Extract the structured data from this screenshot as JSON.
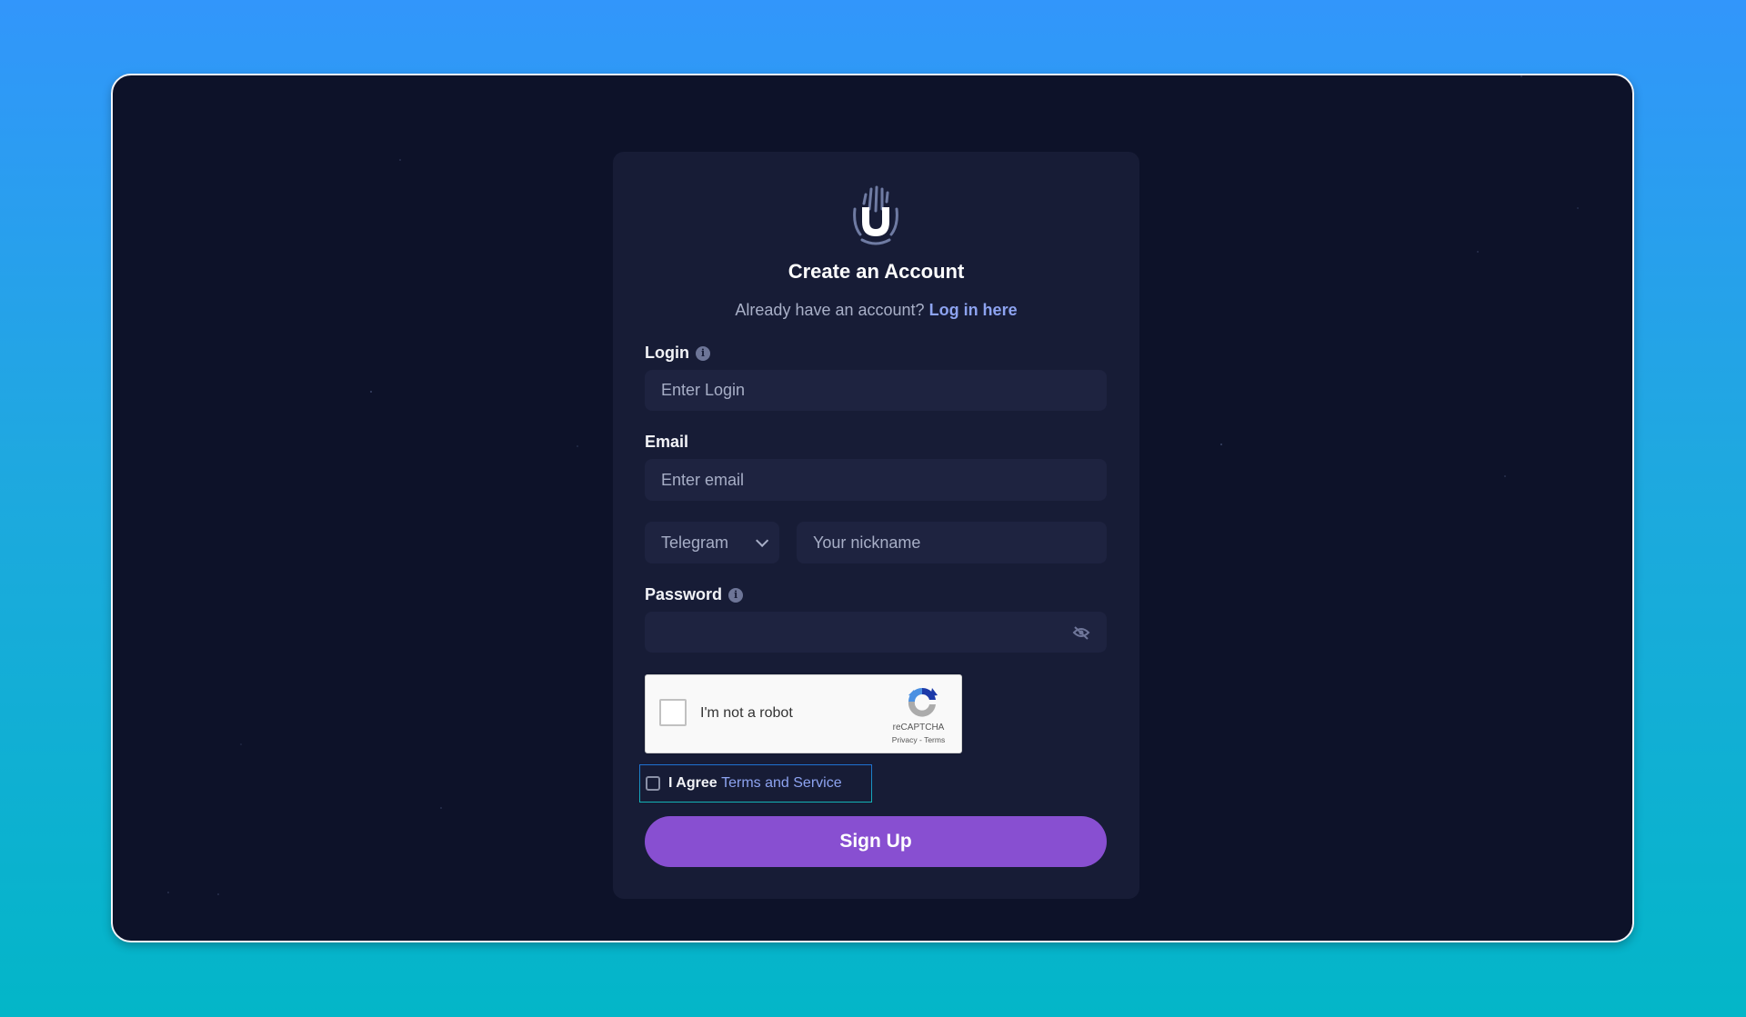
{
  "app": {
    "title": "Create an Account",
    "colors": {
      "page_gradient_top": "#3296fb",
      "page_gradient_bottom": "#03b6c8",
      "frame_bg": "#0d1229",
      "card_bg": "#171c36",
      "input_bg": "#1e2340",
      "accent": "#884fd1",
      "link": "#8da3f0"
    }
  },
  "header": {
    "logo_icon": "fingerprint-u-logo",
    "title": "Create an Account",
    "subtitle": "Already have an account?",
    "login_link": "Log in here"
  },
  "form": {
    "login": {
      "label": "Login",
      "info_icon": "info-icon",
      "placeholder": "Enter Login",
      "value": ""
    },
    "email": {
      "label": "Email",
      "placeholder": "Enter email",
      "value": ""
    },
    "messenger": {
      "selected": "Telegram",
      "chevron_icon": "chevron-down-icon",
      "nickname_placeholder": "Your nickname",
      "nickname_value": ""
    },
    "password": {
      "label": "Password",
      "info_icon": "info-icon",
      "placeholder": "",
      "value": "",
      "visibility_icon": "eye-off-icon"
    },
    "recaptcha": {
      "label": "I'm not a robot",
      "brand": "reCAPTCHA",
      "links": "Privacy - Terms",
      "checked": false
    },
    "agree": {
      "prefix": "I Agree",
      "link": "Terms and Service",
      "checked": false
    },
    "submit_label": "Sign Up"
  }
}
